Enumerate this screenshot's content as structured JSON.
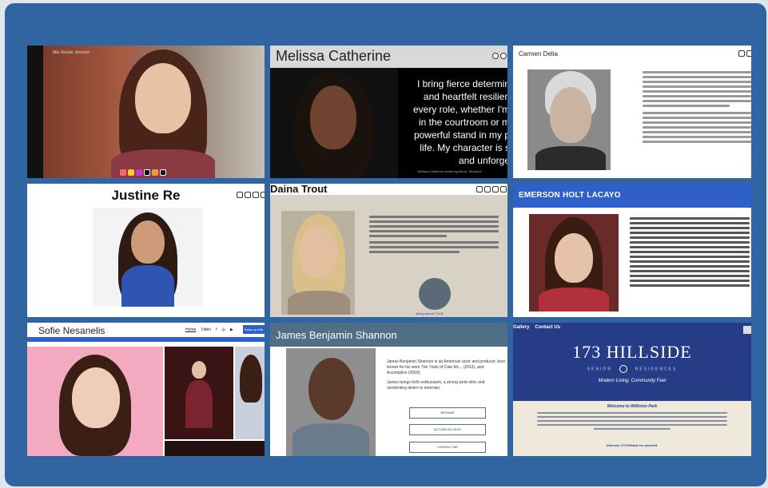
{
  "tiles": {
    "t1": {
      "watermark": "Mia Sinclair Jenness"
    },
    "t2": {
      "name": "Melissa Catherine",
      "quote_lines": [
        "I bring fierce determin",
        "and heartfelt resilien",
        "every role, whether I'm",
        "in the courtroom or m",
        "powerful stand in my p",
        "life. My character is s",
        "and unforge"
      ],
      "caption": "Melissa Catherine rendering fierce, 'Marquee'"
    },
    "t3": {
      "name": "Carmen Delia"
    },
    "t4": {
      "name": "Justine Re"
    },
    "t5": {
      "name": "Daina Trout",
      "link": "@daynatrout TVCB"
    },
    "t6": {
      "name": "EMERSON HOLT LACAYO"
    },
    "t7": {
      "name": "Sofie Nesanelis",
      "nav": [
        "Home",
        "Video"
      ],
      "button": "Keep up with"
    },
    "t8": {
      "name": "James Benjamin Shannon",
      "bio1": "James Benjamin Shannon is an American actor and producer, best known for his work The Trials of Cate Mc... (2013), and Accomplice (2009).",
      "bio2": "James brings forth enthusiasm, a strong work ethic and unrelenting desire to entertain.",
      "buttons": [
        "RESUME",
        "ACTORS ACCESS",
        "CONTACT ME"
      ]
    },
    "t9": {
      "nav": [
        "Gallery",
        "Contact Us"
      ],
      "title": "173 HILLSIDE",
      "sub_left": "SENIOR",
      "sub_right": "RESIDENCES",
      "tagline": "Modern Living, Community Feel",
      "welcome": "Welcome to Williston Park",
      "cta": "Discover 173 Hillside for yourself."
    }
  },
  "colors": {
    "panel": "#3065a2",
    "emerson_bar": "#2f5fc8",
    "hillside_bg": "#263c86",
    "james_bar": "#4e6f86"
  }
}
